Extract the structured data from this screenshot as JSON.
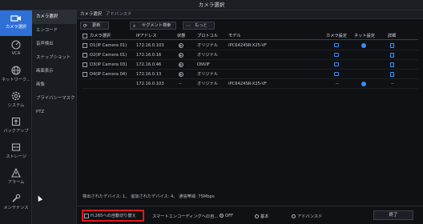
{
  "window": {
    "title": "カメラ選択"
  },
  "leftnav": [
    {
      "label": "カメラ選択",
      "icon": "camera-icon",
      "active": true
    },
    {
      "label": "VCA",
      "icon": "vca-icon"
    },
    {
      "label": "ネットワーク...",
      "icon": "globe-icon"
    },
    {
      "label": "システム",
      "icon": "gear-icon"
    },
    {
      "label": "バックアップ",
      "icon": "backup-icon"
    },
    {
      "label": "ストレージ",
      "icon": "storage-icon"
    },
    {
      "label": "アラーム",
      "icon": "alarm-icon"
    },
    {
      "label": "メンテナンス",
      "icon": "wrench-icon"
    }
  ],
  "subnav": [
    {
      "label": "カメラ選択",
      "active": true
    },
    {
      "label": "エンコード"
    },
    {
      "label": "音声検出"
    },
    {
      "label": "スナップショット"
    },
    {
      "label": "画面表示"
    },
    {
      "label": "画像"
    },
    {
      "label": "プライバシーマスク"
    },
    {
      "label": "PTZ"
    }
  ],
  "tabs": [
    {
      "label": "カメラ選択",
      "active": true
    },
    {
      "label": "アドバンスド"
    }
  ],
  "toolbar": {
    "refresh": "更新",
    "segment_search": "セグメント検索",
    "more": "もっと"
  },
  "table": {
    "headers": [
      "カメラ選択",
      "IPアドレス",
      "状態",
      "プロトコル",
      "モデル",
      "カメラ設定",
      "ネット設定",
      "詳細"
    ],
    "rows": [
      {
        "name": "D1(IP Camera 01)",
        "ip": "172.16.0.103",
        "protocol": "オリジナル",
        "model": "IPC6424SR-X25-VF"
      },
      {
        "name": "D2(IP Camera 01)",
        "ip": "172.16.0.16",
        "protocol": "オリジナル",
        "model": ""
      },
      {
        "name": "D3(IP Camera 03)",
        "ip": "172.16.0.46",
        "protocol": "ONVIF",
        "model": ""
      },
      {
        "name": "D4(IP Camera 04)",
        "ip": "172.16.0.13",
        "protocol": "オリジナル",
        "model": ""
      },
      {
        "name": "",
        "ip": "172.16.0.103",
        "status": "--",
        "protocol": "オリジナル",
        "model": "IPC6424SR-X25-VF",
        "cam": "--",
        "detail": "--"
      }
    ]
  },
  "summary": "検出されたデバイス: 1、 追加されたデバイス: 4、 通信帯域: 75Mbps",
  "footer": {
    "h265": "H.265への自動切り替え",
    "smart_encoding": "スマートエンコーディングへの自...",
    "off": "OFF",
    "basic": "基本",
    "advanced": "アドバンスド",
    "done": "終了"
  },
  "colors": {
    "accent": "#2f6fd8",
    "highlight_box": "#e0161c",
    "link_icon": "#3d8cf0"
  }
}
